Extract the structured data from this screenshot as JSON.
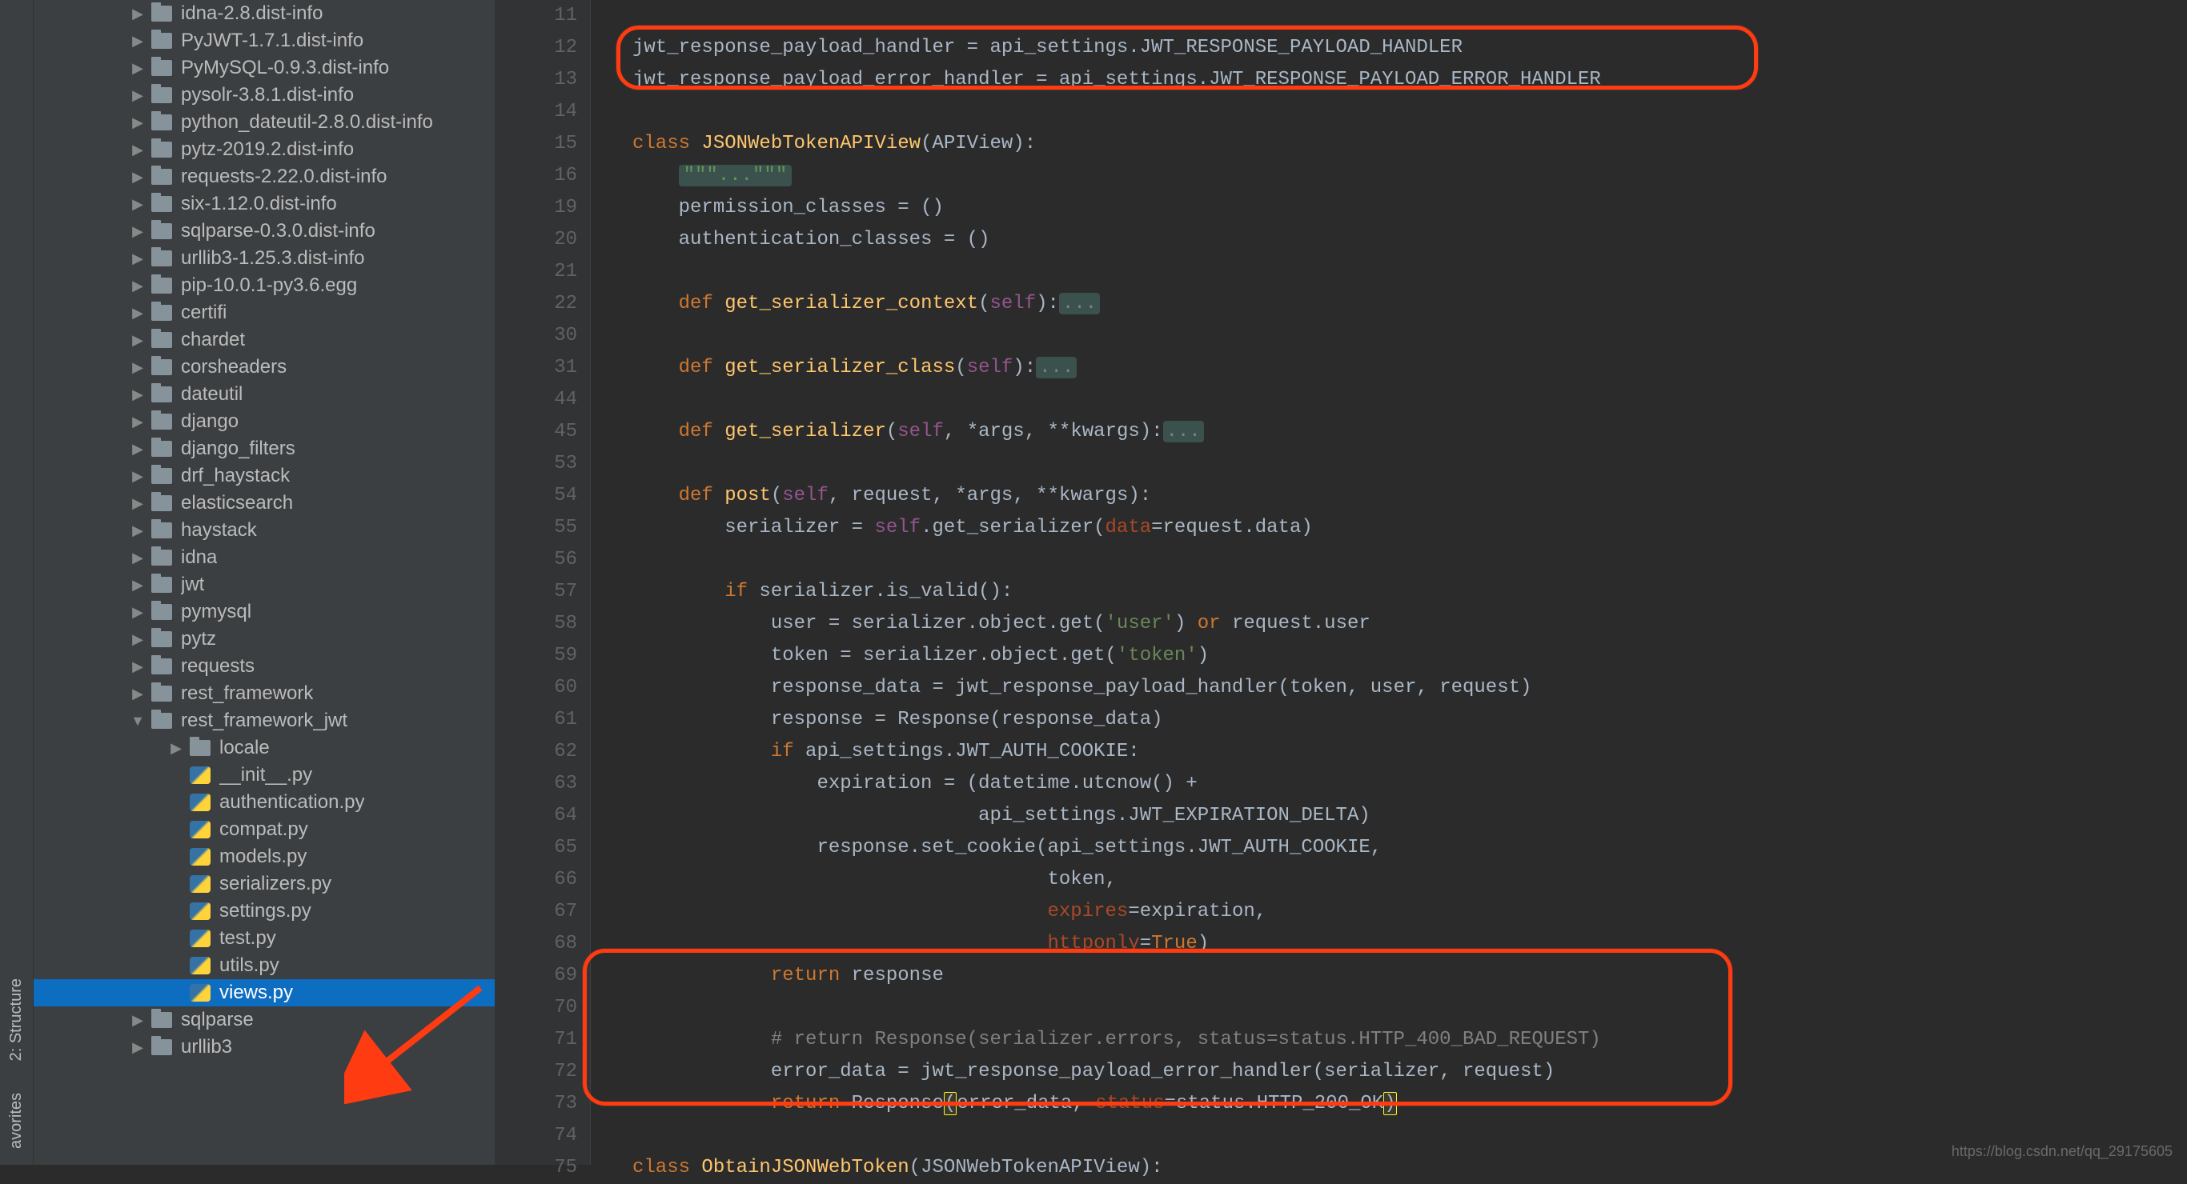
{
  "leftbar": {
    "structure_label": "2: Structure",
    "favorites_label": "avorites"
  },
  "sidebar": {
    "items": [
      {
        "depth": 3,
        "arrow": "▶",
        "type": "folder",
        "label": "idna-2.8.dist-info"
      },
      {
        "depth": 3,
        "arrow": "▶",
        "type": "folder",
        "label": "PyJWT-1.7.1.dist-info"
      },
      {
        "depth": 3,
        "arrow": "▶",
        "type": "folder",
        "label": "PyMySQL-0.9.3.dist-info"
      },
      {
        "depth": 3,
        "arrow": "▶",
        "type": "folder",
        "label": "pysolr-3.8.1.dist-info"
      },
      {
        "depth": 3,
        "arrow": "▶",
        "type": "folder",
        "label": "python_dateutil-2.8.0.dist-info"
      },
      {
        "depth": 3,
        "arrow": "▶",
        "type": "folder",
        "label": "pytz-2019.2.dist-info"
      },
      {
        "depth": 3,
        "arrow": "▶",
        "type": "folder",
        "label": "requests-2.22.0.dist-info"
      },
      {
        "depth": 3,
        "arrow": "▶",
        "type": "folder",
        "label": "six-1.12.0.dist-info"
      },
      {
        "depth": 3,
        "arrow": "▶",
        "type": "folder",
        "label": "sqlparse-0.3.0.dist-info"
      },
      {
        "depth": 3,
        "arrow": "▶",
        "type": "folder",
        "label": "urllib3-1.25.3.dist-info"
      },
      {
        "depth": 3,
        "arrow": "▶",
        "type": "folder",
        "label": "pip-10.0.1-py3.6.egg"
      },
      {
        "depth": 3,
        "arrow": "▶",
        "type": "folder",
        "label": "certifi"
      },
      {
        "depth": 3,
        "arrow": "▶",
        "type": "folder",
        "label": "chardet"
      },
      {
        "depth": 3,
        "arrow": "▶",
        "type": "folder",
        "label": "corsheaders"
      },
      {
        "depth": 3,
        "arrow": "▶",
        "type": "folder",
        "label": "dateutil"
      },
      {
        "depth": 3,
        "arrow": "▶",
        "type": "folder",
        "label": "django"
      },
      {
        "depth": 3,
        "arrow": "▶",
        "type": "folder",
        "label": "django_filters"
      },
      {
        "depth": 3,
        "arrow": "▶",
        "type": "folder",
        "label": "drf_haystack"
      },
      {
        "depth": 3,
        "arrow": "▶",
        "type": "folder",
        "label": "elasticsearch"
      },
      {
        "depth": 3,
        "arrow": "▶",
        "type": "folder",
        "label": "haystack"
      },
      {
        "depth": 3,
        "arrow": "▶",
        "type": "folder",
        "label": "idna"
      },
      {
        "depth": 3,
        "arrow": "▶",
        "type": "folder",
        "label": "jwt"
      },
      {
        "depth": 3,
        "arrow": "▶",
        "type": "folder",
        "label": "pymysql"
      },
      {
        "depth": 3,
        "arrow": "▶",
        "type": "folder",
        "label": "pytz"
      },
      {
        "depth": 3,
        "arrow": "▶",
        "type": "folder",
        "label": "requests"
      },
      {
        "depth": 3,
        "arrow": "▶",
        "type": "folder",
        "label": "rest_framework"
      },
      {
        "depth": 3,
        "arrow": "▼",
        "type": "folder",
        "label": "rest_framework_jwt"
      },
      {
        "depth": 4,
        "arrow": "▶",
        "type": "folder",
        "label": "locale"
      },
      {
        "depth": 4,
        "arrow": "",
        "type": "py",
        "label": "__init__.py"
      },
      {
        "depth": 4,
        "arrow": "",
        "type": "py",
        "label": "authentication.py"
      },
      {
        "depth": 4,
        "arrow": "",
        "type": "py",
        "label": "compat.py"
      },
      {
        "depth": 4,
        "arrow": "",
        "type": "py",
        "label": "models.py"
      },
      {
        "depth": 4,
        "arrow": "",
        "type": "py",
        "label": "serializers.py"
      },
      {
        "depth": 4,
        "arrow": "",
        "type": "py",
        "label": "settings.py"
      },
      {
        "depth": 4,
        "arrow": "",
        "type": "py",
        "label": "test.py"
      },
      {
        "depth": 4,
        "arrow": "",
        "type": "py",
        "label": "utils.py"
      },
      {
        "depth": 4,
        "arrow": "",
        "type": "py",
        "label": "views.py",
        "selected": true
      },
      {
        "depth": 3,
        "arrow": "▶",
        "type": "folder",
        "label": "sqlparse"
      },
      {
        "depth": 3,
        "arrow": "▶",
        "type": "folder",
        "label": "urllib3"
      }
    ]
  },
  "editor": {
    "gutter_lines": [
      "11",
      "12",
      "13",
      "14",
      "15",
      "16",
      "19",
      "20",
      "21",
      "22",
      "30",
      "31",
      "44",
      "45",
      "53",
      "54",
      "55",
      "56",
      "57",
      "58",
      "59",
      "60",
      "61",
      "62",
      "63",
      "64",
      "65",
      "66",
      "67",
      "68",
      "69",
      "70",
      "71",
      "72",
      "73",
      "74",
      "75"
    ],
    "gutter_marks": {
      "15": "down",
      "16": "",
      "19": "up",
      "20": "up"
    }
  },
  "code_lines": [
    {
      "n": "11",
      "html": ""
    },
    {
      "n": "12",
      "html": "jwt_response_payload_handler <span class='op'>=</span> api_settings.JWT_RESPONSE_PAYLOAD_HANDLER"
    },
    {
      "n": "13",
      "html": "jwt_response_payload_error_handler <span class='op'>=</span> api_settings.JWT_RESPONSE_PAYLOAD_ERROR_HANDLER"
    },
    {
      "n": "14",
      "html": ""
    },
    {
      "n": "15",
      "html": "<span class='kw'>class</span> <span class='def-name'>JSONWebTokenAPIView</span>(APIView):"
    },
    {
      "n": "16",
      "html": "    <span class='folded-doc'>\"\"\"...\"\"\"</span>"
    },
    {
      "n": "19",
      "html": "    permission_classes <span class='op'>=</span> ()"
    },
    {
      "n": "20",
      "html": "    authentication_classes <span class='op'>=</span> ()"
    },
    {
      "n": "21",
      "html": ""
    },
    {
      "n": "22",
      "html": "    <span class='kw'>def</span> <span class='fn'>get_serializer_context</span>(<span class='self'>self</span>):<span class='folded'>...</span>"
    },
    {
      "n": "30",
      "html": ""
    },
    {
      "n": "31",
      "html": "    <span class='kw'>def</span> <span class='fn'>get_serializer_class</span>(<span class='self'>self</span>):<span class='folded'>...</span>"
    },
    {
      "n": "44",
      "html": ""
    },
    {
      "n": "45",
      "html": "    <span class='kw'>def</span> <span class='fn'>get_serializer</span>(<span class='self'>self</span><span class='op'>,</span> *args<span class='op'>,</span> **kwargs):<span class='folded'>...</span>"
    },
    {
      "n": "53",
      "html": ""
    },
    {
      "n": "54",
      "html": "    <span class='kw'>def</span> <span class='fn'>post</span>(<span class='self'>self</span><span class='op'>,</span> request<span class='op'>,</span> *args<span class='op'>,</span> **kwargs):"
    },
    {
      "n": "55",
      "html": "        serializer <span class='op'>=</span> <span class='self'>self</span>.get_serializer(<span class='named-arg'>data</span><span class='op'>=</span>request.data)"
    },
    {
      "n": "56",
      "html": ""
    },
    {
      "n": "57",
      "html": "        <span class='kw'>if</span> serializer.is_valid():"
    },
    {
      "n": "58",
      "html": "            user <span class='op'>=</span> serializer.object.get(<span class='str'>'user'</span>) <span class='kw'>or</span> request.user"
    },
    {
      "n": "59",
      "html": "            token <span class='op'>=</span> serializer.object.get(<span class='str'>'token'</span>)"
    },
    {
      "n": "60",
      "html": "            response_data <span class='op'>=</span> jwt_response_payload_handler(token<span class='op'>,</span> user<span class='op'>,</span> request)"
    },
    {
      "n": "61",
      "html": "            response <span class='op'>=</span> Response(response_data)"
    },
    {
      "n": "62",
      "html": "            <span class='kw'>if</span> api_settings.JWT_AUTH_COOKIE:"
    },
    {
      "n": "63",
      "html": "                expiration <span class='op'>=</span> (datetime.utcnow() <span class='op'>+</span>"
    },
    {
      "n": "64",
      "html": "                              api_settings.JWT_EXPIRATION_DELTA)"
    },
    {
      "n": "65",
      "html": "                response.set_cookie(api_settings.JWT_AUTH_COOKIE<span class='op'>,</span>"
    },
    {
      "n": "66",
      "html": "                                    token<span class='op'>,</span>"
    },
    {
      "n": "67",
      "html": "                                    <span class='named-arg'>expires</span><span class='op'>=</span>expiration<span class='op'>,</span>"
    },
    {
      "n": "68",
      "html": "                                    <span class='named-arg'>httponly</span><span class='op'>=</span><span class='kw'>True</span>)"
    },
    {
      "n": "69",
      "html": "            <span class='kw'>return</span> response"
    },
    {
      "n": "70",
      "html": ""
    },
    {
      "n": "71",
      "html": "            <span class='comment'># return Response(serializer.errors, status=status.HTTP_400_BAD_REQUEST)</span>"
    },
    {
      "n": "72",
      "html": "            error_data <span class='op'>=</span> jwt_response_payload_error_handler(serializer<span class='op'>,</span> request)"
    },
    {
      "n": "73",
      "html": "            <span class='kw'>return</span> Response<span class='highlight-paren'>(</span>error_data<span class='op'>,</span> <span class='named-arg'>status</span><span class='op'>=</span>status.HTTP_200_OK<span class='highlight-paren'>)</span>"
    },
    {
      "n": "74",
      "html": ""
    },
    {
      "n": "75",
      "html": "<span class='kw'>class</span> <span class='def-name'>ObtainJSONWebToken</span>(JSONWebTokenAPIView):"
    }
  ],
  "watermark": "https://blog.csdn.net/qq_29175605"
}
